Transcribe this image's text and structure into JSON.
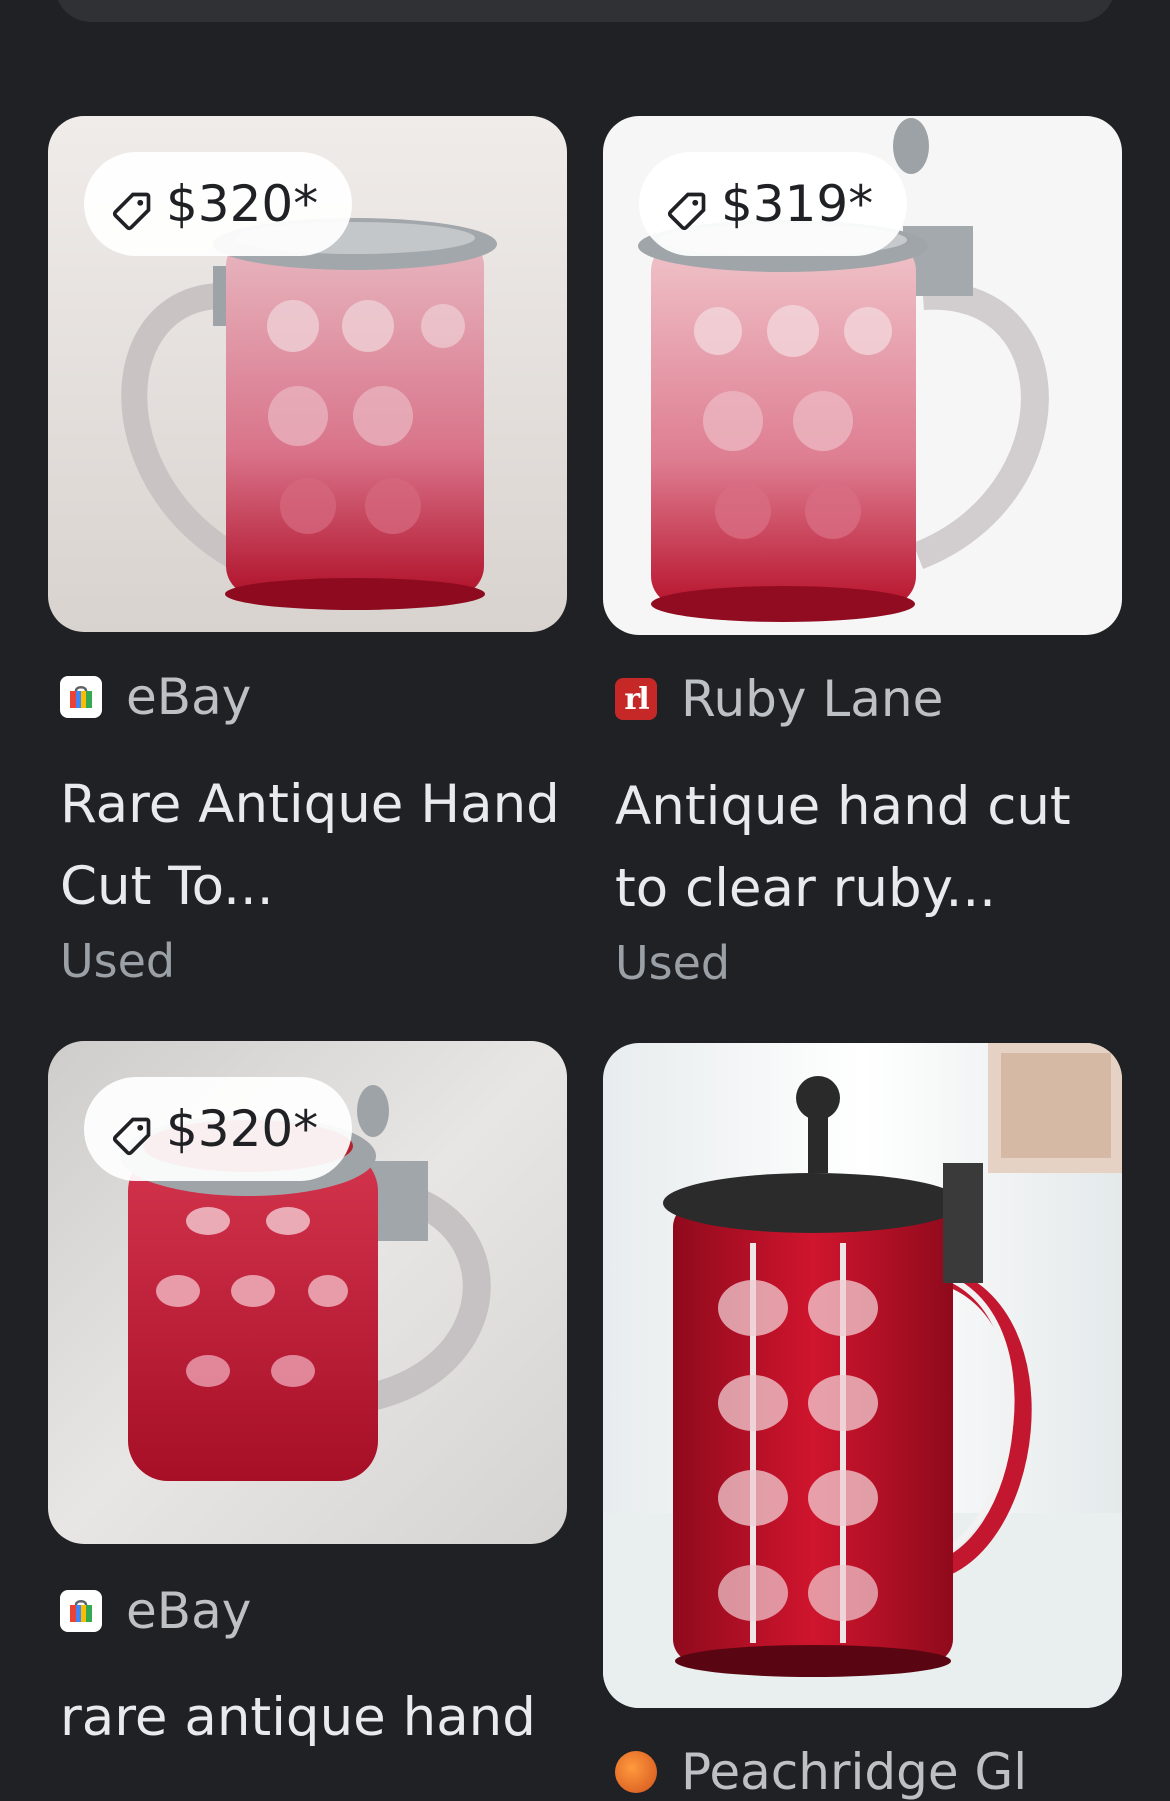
{
  "results": [
    {
      "price": "$320*",
      "source": "eBay",
      "source_icon": "ebay-shopping-bag-icon",
      "title": "Rare Antique Hand Cut To...",
      "condition": "Used"
    },
    {
      "price": "$319*",
      "source": "Ruby Lane",
      "source_icon": "ruby-lane-icon",
      "favicon_text": "rl",
      "title": "Antique hand cut to clear ruby...",
      "condition": "Used"
    },
    {
      "price": "$320*",
      "source": "eBay",
      "source_icon": "ebay-shopping-bag-icon",
      "title": "rare antique hand"
    },
    {
      "source": "Peachridge Gl",
      "source_icon": "peachridge-icon"
    }
  ],
  "colors": {
    "background": "#202124",
    "chip_background": "#ffffff",
    "source_text": "#bdc1c6",
    "condition_text": "#9aa0a6",
    "ruby_lane_brand": "#c62828"
  }
}
